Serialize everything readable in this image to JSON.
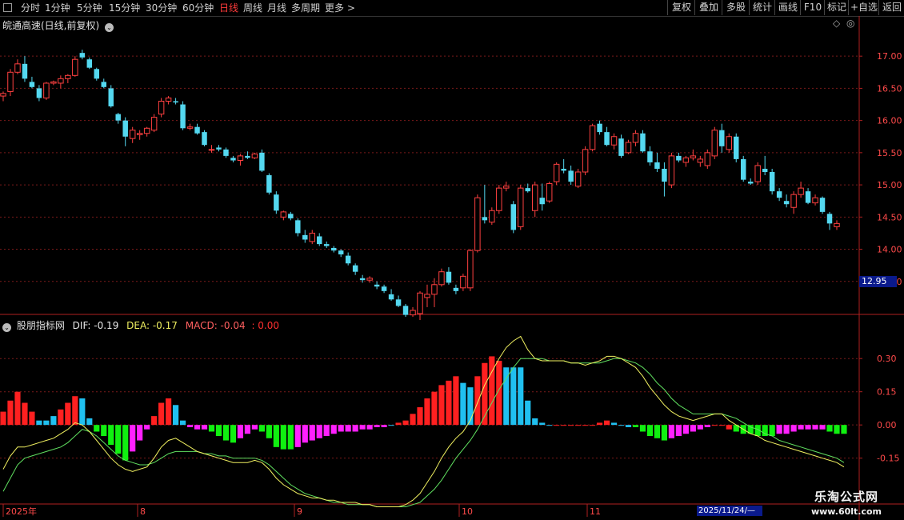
{
  "toolbar": {
    "periods": [
      {
        "label": "分时"
      },
      {
        "label": "1分钟"
      },
      {
        "label": "5分钟"
      },
      {
        "label": "15分钟"
      },
      {
        "label": "30分钟"
      },
      {
        "label": "60分钟"
      },
      {
        "label": "日线",
        "active": true
      },
      {
        "label": "周线"
      },
      {
        "label": "月线"
      },
      {
        "label": "多周期"
      },
      {
        "label": "更多 >"
      }
    ],
    "buttons": [
      "复权",
      "叠加",
      "多股",
      "统计",
      "画线",
      "F10",
      "标记",
      "+自选",
      "返回"
    ]
  },
  "main_title": "皖通高速(日线,前复权)",
  "indicator_title": "股朋指标网",
  "indicator_values": {
    "dif": "DIF: -0.19",
    "dea": "DEA: -0.17",
    "macd": "MACD: -0.04",
    "extra": ": 0.00"
  },
  "last_price_tag": "12.95",
  "date_tag": "2025/11/24/—",
  "watermark": {
    "line1": "乐淘公式网",
    "line2": "www.60lt.com"
  },
  "colors": {
    "up": "#ff4040",
    "down": "#54d8f0",
    "dif": "#f0f060",
    "dea": "#60e060",
    "macd_red": "#ff2020",
    "macd_cyan": "#20c0f0",
    "macd_green": "#10f010",
    "macd_magenta": "#ff20ff"
  },
  "chart_data": [
    {
      "type": "candlestick",
      "y_ticks": [
        "17.00",
        "16.50",
        "16.00",
        "15.50",
        "15.00",
        "14.50",
        "14.00",
        "13.50"
      ],
      "ylim": [
        13.0,
        17.4
      ],
      "x_ticks": [
        "2025年",
        "8",
        "9",
        "10",
        "11"
      ],
      "ohlc": [
        [
          16.38,
          16.45,
          16.3,
          16.42
        ],
        [
          16.45,
          16.8,
          16.38,
          16.75
        ],
        [
          16.75,
          16.95,
          16.72,
          16.88
        ],
        [
          16.88,
          17.0,
          16.6,
          16.65
        ],
        [
          16.6,
          16.68,
          16.5,
          16.52
        ],
        [
          16.5,
          16.55,
          16.3,
          16.35
        ],
        [
          16.35,
          16.6,
          16.32,
          16.58
        ],
        [
          16.58,
          16.62,
          16.55,
          16.6
        ],
        [
          16.58,
          16.7,
          16.5,
          16.65
        ],
        [
          16.65,
          16.72,
          16.58,
          16.7
        ],
        [
          16.7,
          17.0,
          16.68,
          16.95
        ],
        [
          17.05,
          17.1,
          16.95,
          16.98
        ],
        [
          16.95,
          16.98,
          16.8,
          16.82
        ],
        [
          16.8,
          16.82,
          16.62,
          16.65
        ],
        [
          16.6,
          16.65,
          16.5,
          16.52
        ],
        [
          16.5,
          16.55,
          16.2,
          16.22
        ],
        [
          16.1,
          16.12,
          15.95,
          16.0
        ],
        [
          16.0,
          16.05,
          15.6,
          15.75
        ],
        [
          15.72,
          15.9,
          15.65,
          15.85
        ],
        [
          15.78,
          15.85,
          15.7,
          15.8
        ],
        [
          15.8,
          15.9,
          15.75,
          15.88
        ],
        [
          15.85,
          16.1,
          15.82,
          16.05
        ],
        [
          16.1,
          16.35,
          16.05,
          16.3
        ],
        [
          16.3,
          16.38,
          16.25,
          16.35
        ],
        [
          16.3,
          16.35,
          16.25,
          16.28
        ],
        [
          16.25,
          16.3,
          15.85,
          15.88
        ],
        [
          15.88,
          15.95,
          15.85,
          15.9
        ],
        [
          15.9,
          15.95,
          15.78,
          15.8
        ],
        [
          15.82,
          15.85,
          15.6,
          15.62
        ],
        [
          15.55,
          15.62,
          15.5,
          15.55
        ],
        [
          15.58,
          15.62,
          15.52,
          15.55
        ],
        [
          15.55,
          15.58,
          15.42,
          15.45
        ],
        [
          15.42,
          15.45,
          15.35,
          15.38
        ],
        [
          15.38,
          15.48,
          15.3,
          15.45
        ],
        [
          15.45,
          15.52,
          15.4,
          15.42
        ],
        [
          15.42,
          15.5,
          15.4,
          15.48
        ],
        [
          15.5,
          15.55,
          15.2,
          15.22
        ],
        [
          15.15,
          15.18,
          14.85,
          14.88
        ],
        [
          14.85,
          14.9,
          14.55,
          14.6
        ],
        [
          14.5,
          14.6,
          14.45,
          14.58
        ],
        [
          14.55,
          14.58,
          14.45,
          14.48
        ],
        [
          14.45,
          14.48,
          14.2,
          14.25
        ],
        [
          14.22,
          14.3,
          14.1,
          14.15
        ],
        [
          14.12,
          14.3,
          14.08,
          14.25
        ],
        [
          14.2,
          14.25,
          14.05,
          14.08
        ],
        [
          14.08,
          14.12,
          14.02,
          14.05
        ],
        [
          14.02,
          14.05,
          13.95,
          13.98
        ],
        [
          13.98,
          14.0,
          13.88,
          13.92
        ],
        [
          13.9,
          13.95,
          13.75,
          13.78
        ],
        [
          13.75,
          13.78,
          13.6,
          13.65
        ],
        [
          13.55,
          13.6,
          13.48,
          13.52
        ],
        [
          13.52,
          13.58,
          13.48,
          13.55
        ],
        [
          13.45,
          13.5,
          13.38,
          13.42
        ],
        [
          13.42,
          13.45,
          13.32,
          13.35
        ],
        [
          13.3,
          13.38,
          13.2,
          13.22
        ],
        [
          13.22,
          13.28,
          13.1,
          13.12
        ],
        [
          13.12,
          13.15,
          12.95,
          12.98
        ],
        [
          12.98,
          13.1,
          12.95,
          13.05
        ],
        [
          13.0,
          13.35,
          12.9,
          13.32
        ],
        [
          13.25,
          13.45,
          13.1,
          13.3
        ],
        [
          13.3,
          13.55,
          13.1,
          13.45
        ],
        [
          13.45,
          13.7,
          13.42,
          13.65
        ],
        [
          13.65,
          13.72,
          13.45,
          13.48
        ],
        [
          13.4,
          13.45,
          13.3,
          13.35
        ],
        [
          13.4,
          13.62,
          13.35,
          13.58
        ],
        [
          13.4,
          14.0,
          13.35,
          13.98
        ],
        [
          13.98,
          14.85,
          13.95,
          14.8
        ],
        [
          14.5,
          15.0,
          14.4,
          14.45
        ],
        [
          14.42,
          14.65,
          14.38,
          14.6
        ],
        [
          14.6,
          15.0,
          14.55,
          14.95
        ],
        [
          14.95,
          15.05,
          14.9,
          14.98
        ],
        [
          14.7,
          14.75,
          14.25,
          14.3
        ],
        [
          14.35,
          15.0,
          14.3,
          14.95
        ],
        [
          14.95,
          15.02,
          14.88,
          14.9
        ],
        [
          14.6,
          15.05,
          14.5,
          15.0
        ],
        [
          14.8,
          15.02,
          14.6,
          14.7
        ],
        [
          14.75,
          15.05,
          14.72,
          15.02
        ],
        [
          15.05,
          15.35,
          15.0,
          15.32
        ],
        [
          15.25,
          15.4,
          15.18,
          15.22
        ],
        [
          15.22,
          15.3,
          15.0,
          15.05
        ],
        [
          14.98,
          15.25,
          14.95,
          15.2
        ],
        [
          15.2,
          15.6,
          15.15,
          15.55
        ],
        [
          15.55,
          15.95,
          15.52,
          15.92
        ],
        [
          15.95,
          16.0,
          15.78,
          15.82
        ],
        [
          15.82,
          15.9,
          15.6,
          15.62
        ],
        [
          15.62,
          15.8,
          15.55,
          15.75
        ],
        [
          15.72,
          15.78,
          15.42,
          15.45
        ],
        [
          15.5,
          15.7,
          15.48,
          15.66
        ],
        [
          15.66,
          15.85,
          15.6,
          15.8
        ],
        [
          15.8,
          15.85,
          15.5,
          15.52
        ],
        [
          15.52,
          15.6,
          15.3,
          15.35
        ],
        [
          15.35,
          15.5,
          15.2,
          15.25
        ],
        [
          15.25,
          15.35,
          14.82,
          15.05
        ],
        [
          15.0,
          15.5,
          14.95,
          15.45
        ],
        [
          15.45,
          15.5,
          15.35,
          15.38
        ],
        [
          15.35,
          15.45,
          15.28,
          15.42
        ],
        [
          15.42,
          15.55,
          15.38,
          15.45
        ],
        [
          15.35,
          15.45,
          15.28,
          15.4
        ],
        [
          15.3,
          15.55,
          15.25,
          15.5
        ],
        [
          15.45,
          15.9,
          15.4,
          15.85
        ],
        [
          15.85,
          15.95,
          15.5,
          15.6
        ],
        [
          15.55,
          15.8,
          15.5,
          15.75
        ],
        [
          15.75,
          15.8,
          15.35,
          15.4
        ],
        [
          15.4,
          15.45,
          15.05,
          15.08
        ],
        [
          15.05,
          15.1,
          15.0,
          15.02
        ],
        [
          15.05,
          15.35,
          15.0,
          15.3
        ],
        [
          15.25,
          15.45,
          15.15,
          15.2
        ],
        [
          15.2,
          15.25,
          14.85,
          14.9
        ],
        [
          14.9,
          14.95,
          14.75,
          14.8
        ],
        [
          14.75,
          14.85,
          14.65,
          14.7
        ],
        [
          14.65,
          14.9,
          14.55,
          14.85
        ],
        [
          14.85,
          15.05,
          14.8,
          14.95
        ],
        [
          14.9,
          14.95,
          14.7,
          14.72
        ],
        [
          14.72,
          14.85,
          14.68,
          14.8
        ],
        [
          14.8,
          14.82,
          14.55,
          14.58
        ],
        [
          14.55,
          14.58,
          14.3,
          14.4
        ],
        [
          14.35,
          14.45,
          14.3,
          14.4
        ]
      ]
    },
    {
      "type": "macd",
      "title": "股朋指标网",
      "y_ticks": [
        "0.30",
        "0.15",
        "0.00",
        "-0.15"
      ],
      "ylim": [
        -0.35,
        0.42
      ],
      "series": [
        {
          "name": "DIF"
        },
        {
          "name": "DEA"
        },
        {
          "name": "MACD"
        }
      ],
      "dif": [
        -0.2,
        -0.14,
        -0.1,
        -0.1,
        -0.09,
        -0.08,
        -0.07,
        -0.06,
        -0.04,
        -0.02,
        0.01,
        0.0,
        -0.03,
        -0.07,
        -0.11,
        -0.15,
        -0.18,
        -0.2,
        -0.21,
        -0.2,
        -0.19,
        -0.15,
        -0.1,
        -0.07,
        -0.06,
        -0.08,
        -0.1,
        -0.12,
        -0.13,
        -0.14,
        -0.15,
        -0.16,
        -0.17,
        -0.17,
        -0.17,
        -0.16,
        -0.17,
        -0.2,
        -0.24,
        -0.27,
        -0.29,
        -0.31,
        -0.32,
        -0.33,
        -0.33,
        -0.34,
        -0.34,
        -0.35,
        -0.35,
        -0.35,
        -0.36,
        -0.36,
        -0.37,
        -0.37,
        -0.37,
        -0.37,
        -0.36,
        -0.34,
        -0.31,
        -0.26,
        -0.21,
        -0.15,
        -0.1,
        -0.06,
        -0.03,
        0.02,
        0.1,
        0.18,
        0.24,
        0.3,
        0.35,
        0.38,
        0.4,
        0.34,
        0.3,
        0.29,
        0.29,
        0.29,
        0.29,
        0.28,
        0.28,
        0.27,
        0.28,
        0.29,
        0.31,
        0.31,
        0.3,
        0.28,
        0.26,
        0.22,
        0.17,
        0.13,
        0.09,
        0.06,
        0.04,
        0.03,
        0.02,
        0.03,
        0.04,
        0.05,
        0.05,
        0.02,
        0.0,
        -0.02,
        -0.04,
        -0.05,
        -0.07,
        -0.08,
        -0.09,
        -0.1,
        -0.11,
        -0.12,
        -0.13,
        -0.14,
        -0.15,
        -0.16,
        -0.17,
        -0.19
      ],
      "dea": [
        -0.3,
        -0.24,
        -0.18,
        -0.15,
        -0.14,
        -0.13,
        -0.12,
        -0.11,
        -0.1,
        -0.08,
        -0.05,
        -0.02,
        -0.03,
        -0.05,
        -0.08,
        -0.11,
        -0.14,
        -0.16,
        -0.17,
        -0.18,
        -0.18,
        -0.17,
        -0.15,
        -0.13,
        -0.12,
        -0.12,
        -0.12,
        -0.12,
        -0.13,
        -0.13,
        -0.14,
        -0.14,
        -0.15,
        -0.15,
        -0.15,
        -0.15,
        -0.16,
        -0.18,
        -0.21,
        -0.24,
        -0.27,
        -0.29,
        -0.31,
        -0.32,
        -0.33,
        -0.34,
        -0.35,
        -0.35,
        -0.36,
        -0.36,
        -0.36,
        -0.36,
        -0.37,
        -0.37,
        -0.37,
        -0.37,
        -0.37,
        -0.36,
        -0.35,
        -0.32,
        -0.29,
        -0.25,
        -0.2,
        -0.15,
        -0.11,
        -0.07,
        -0.02,
        0.04,
        0.1,
        0.16,
        0.21,
        0.26,
        0.3,
        0.3,
        0.3,
        0.3,
        0.29,
        0.29,
        0.29,
        0.28,
        0.28,
        0.28,
        0.28,
        0.28,
        0.29,
        0.3,
        0.3,
        0.29,
        0.28,
        0.26,
        0.23,
        0.19,
        0.16,
        0.12,
        0.09,
        0.07,
        0.05,
        0.05,
        0.05,
        0.05,
        0.05,
        0.04,
        0.03,
        0.01,
        -0.01,
        -0.02,
        -0.04,
        -0.05,
        -0.07,
        -0.08,
        -0.09,
        -0.1,
        -0.11,
        -0.12,
        -0.13,
        -0.14,
        -0.15,
        -0.17
      ],
      "macd": [
        0.06,
        0.11,
        0.15,
        0.1,
        0.06,
        0.02,
        0.02,
        0.04,
        0.07,
        0.1,
        0.13,
        0.12,
        0.03,
        -0.03,
        -0.05,
        -0.09,
        -0.13,
        -0.16,
        -0.12,
        -0.07,
        -0.02,
        0.04,
        0.1,
        0.12,
        0.09,
        0.02,
        -0.01,
        -0.02,
        -0.02,
        -0.03,
        -0.05,
        -0.07,
        -0.08,
        -0.06,
        -0.04,
        -0.02,
        -0.03,
        -0.06,
        -0.1,
        -0.11,
        -0.11,
        -0.1,
        -0.08,
        -0.07,
        -0.06,
        -0.05,
        -0.04,
        -0.03,
        -0.03,
        -0.03,
        -0.02,
        -0.02,
        -0.01,
        -0.01,
        0.0,
        0.01,
        0.02,
        0.05,
        0.08,
        0.12,
        0.15,
        0.18,
        0.2,
        0.22,
        0.19,
        0.17,
        0.22,
        0.28,
        0.31,
        0.29,
        0.26,
        0.26,
        0.26,
        0.11,
        0.03,
        0.01,
        0.0,
        0.0,
        0.0,
        0.0,
        0.0,
        0.0,
        0.0,
        0.01,
        0.02,
        0.01,
        0.0,
        -0.01,
        -0.01,
        -0.03,
        -0.05,
        -0.06,
        -0.07,
        -0.06,
        -0.05,
        -0.04,
        -0.03,
        -0.02,
        -0.01,
        0.0,
        0.0,
        -0.02,
        -0.03,
        -0.04,
        -0.04,
        -0.05,
        -0.05,
        -0.05,
        -0.04,
        -0.04,
        -0.03,
        -0.02,
        -0.02,
        -0.02,
        -0.02,
        -0.03,
        -0.04,
        -0.04
      ],
      "macd_colors": [
        "r",
        "r",
        "r",
        "r",
        "r",
        "c",
        "c",
        "c",
        "r",
        "r",
        "r",
        "c",
        "c",
        "g",
        "g",
        "g",
        "g",
        "g",
        "m",
        "m",
        "m",
        "r",
        "r",
        "r",
        "c",
        "c",
        "m",
        "m",
        "m",
        "g",
        "g",
        "g",
        "g",
        "m",
        "m",
        "m",
        "g",
        "g",
        "g",
        "g",
        "g",
        "m",
        "m",
        "m",
        "m",
        "m",
        "m",
        "m",
        "m",
        "m",
        "m",
        "m",
        "m",
        "m",
        "c",
        "r",
        "r",
        "r",
        "r",
        "r",
        "r",
        "r",
        "r",
        "r",
        "c",
        "c",
        "r",
        "r",
        "r",
        "r",
        "c",
        "c",
        "c",
        "c",
        "c",
        "c",
        "c",
        "r",
        "r",
        "r",
        "r",
        "r",
        "r",
        "r",
        "r",
        "c",
        "c",
        "c",
        "g",
        "g",
        "g",
        "g",
        "g",
        "m",
        "m",
        "m",
        "m",
        "m",
        "m",
        "r",
        "r",
        "r",
        "g",
        "g",
        "g",
        "g",
        "g",
        "g",
        "m",
        "m",
        "m",
        "m",
        "m",
        "m",
        "m",
        "g",
        "g",
        "g"
      ]
    }
  ]
}
